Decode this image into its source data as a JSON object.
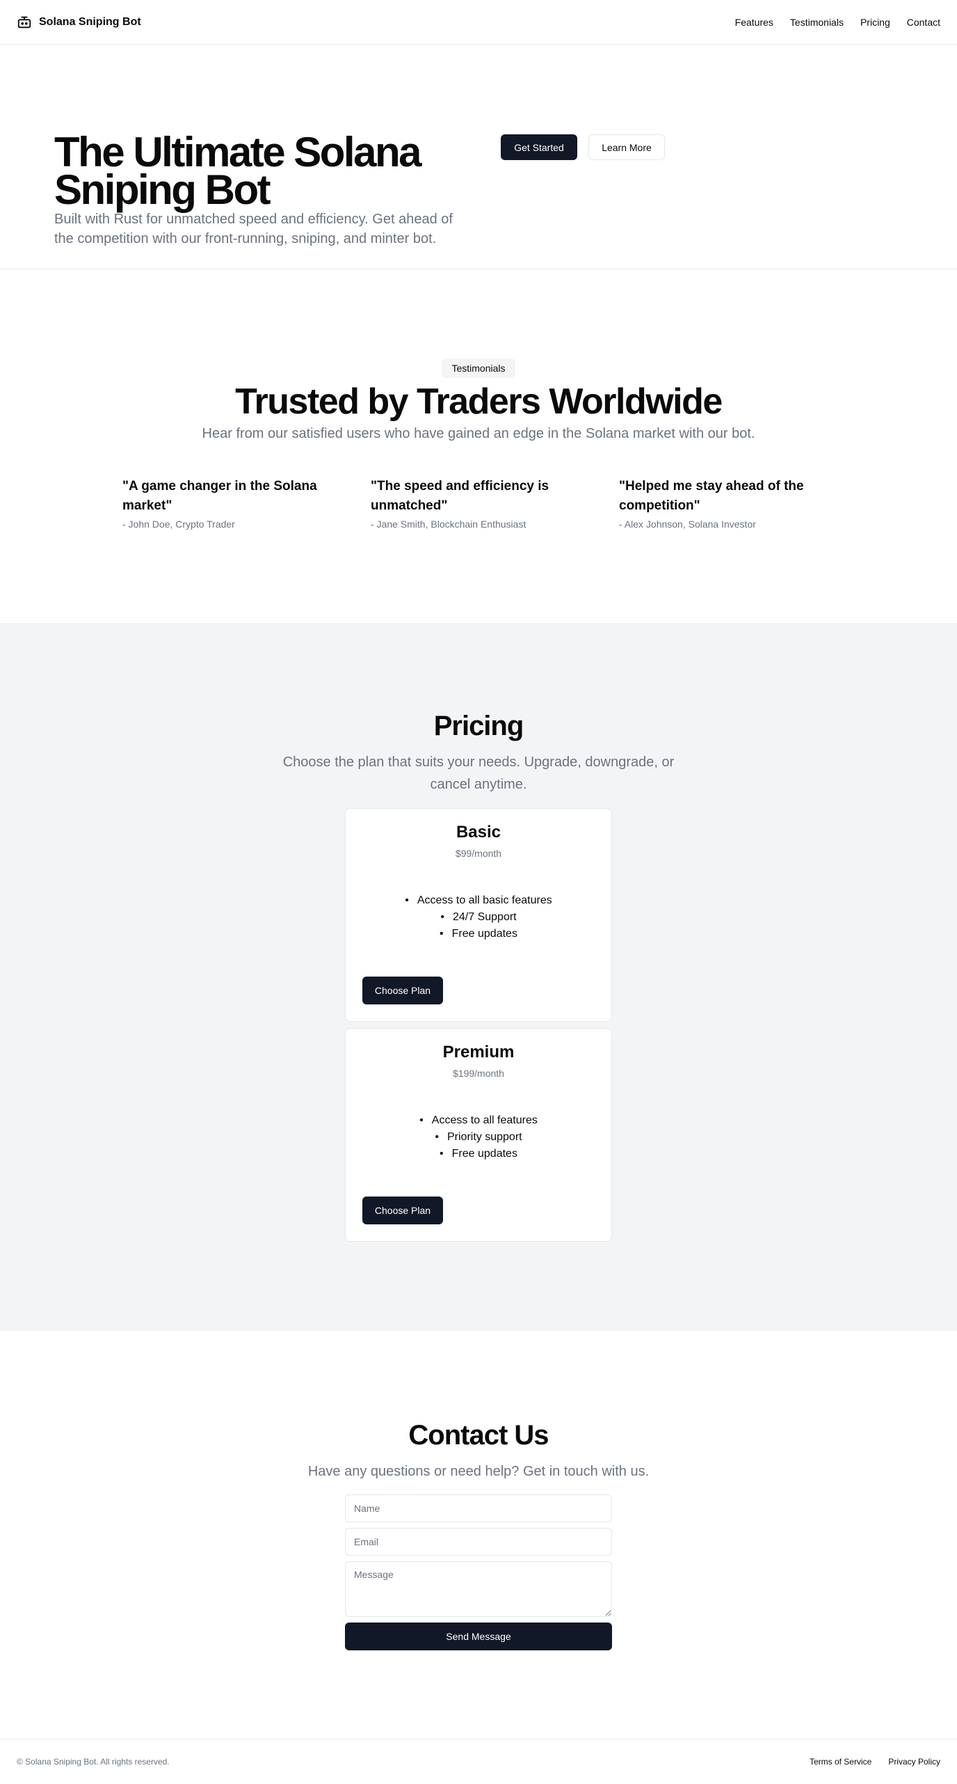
{
  "header": {
    "brand": "Solana Sniping Bot",
    "nav": [
      "Features",
      "Testimonials",
      "Pricing",
      "Contact"
    ]
  },
  "hero": {
    "title": "The Ultimate Solana Sniping Bot",
    "subtitle": "Built with Rust for unmatched speed and efficiency. Get ahead of the competition with our front-running, sniping, and minter bot.",
    "primary_button": "Get Started",
    "secondary_button": "Learn More"
  },
  "testimonials": {
    "badge": "Testimonials",
    "title": "Trusted by Traders Worldwide",
    "subtitle": "Hear from our satisfied users who have gained an edge in the Solana market with our bot.",
    "items": [
      {
        "quote": "\"A game changer in the Solana market\"",
        "author": "- John Doe, Crypto Trader"
      },
      {
        "quote": "\"The speed and efficiency is unmatched\"",
        "author": "- Jane Smith, Blockchain Enthusiast"
      },
      {
        "quote": "\"Helped me stay ahead of the competition\"",
        "author": "- Alex Johnson, Solana Investor"
      }
    ]
  },
  "pricing": {
    "title": "Pricing",
    "subtitle": "Choose the plan that suits your needs. Upgrade, downgrade, or cancel anytime.",
    "plans": [
      {
        "name": "Basic",
        "price": "$99/month",
        "features": [
          "Access to all basic features",
          "24/7 Support",
          "Free updates"
        ],
        "button": "Choose Plan"
      },
      {
        "name": "Premium",
        "price": "$199/month",
        "features": [
          "Access to all features",
          "Priority support",
          "Free updates"
        ],
        "button": "Choose Plan"
      }
    ]
  },
  "contact": {
    "title": "Contact Us",
    "subtitle": "Have any questions or need help? Get in touch with us.",
    "name_placeholder": "Name",
    "email_placeholder": "Email",
    "message_placeholder": "Message",
    "button": "Send Message"
  },
  "footer": {
    "copyright": "© Solana Sniping Bot. All rights reserved.",
    "links": [
      "Terms of Service",
      "Privacy Policy"
    ]
  },
  "colors": {
    "primary": "#111827",
    "muted_text": "#6b7280",
    "section_bg": "#f3f4f6",
    "border": "#e5e7eb"
  },
  "icons": {
    "brand": "bot-icon"
  }
}
